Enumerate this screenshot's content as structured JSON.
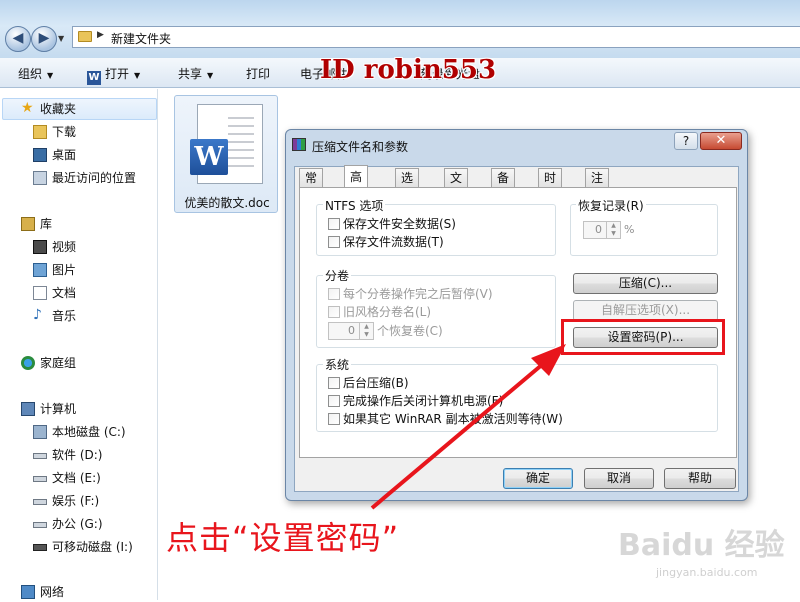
{
  "explorer": {
    "breadcrumb": "新建文件夹",
    "toolbar": {
      "organize": "组织",
      "open": "打开",
      "share": "共享",
      "print": "打印",
      "email": "电子邮件",
      "burn": "刻录到光盘"
    },
    "sidebar": {
      "favorites": "收藏夹",
      "downloads": "下载",
      "desktop": "桌面",
      "recent": "最近访问的位置",
      "libraries": "库",
      "videos": "视频",
      "pictures": "图片",
      "documents": "文档",
      "music": "音乐",
      "homegroup": "家庭组",
      "computer": "计算机",
      "drives": [
        "本地磁盘 (C:)",
        "软件 (D:)",
        "文档 (E:)",
        "娱乐 (F:)",
        "办公 (G:)",
        "可移动磁盘 (I:)"
      ],
      "network": "网络"
    },
    "file": {
      "name": "优美的散文.doc"
    }
  },
  "watermark": "ID robin553",
  "dialog": {
    "title": "压缩文件名和参数",
    "help": "?",
    "close": "✕",
    "tabs": [
      "常规",
      "高级",
      "选项",
      "文件",
      "备份",
      "时间",
      "注释"
    ],
    "active_tab": "高级",
    "ntfs": {
      "title": "NTFS 选项",
      "items": [
        "保存文件安全数据(S)",
        "保存文件流数据(T)"
      ]
    },
    "recovery": {
      "title": "恢复记录(R)",
      "value": "0",
      "unit": "%"
    },
    "volumes": {
      "title": "分卷",
      "items": [
        "每个分卷操作完之后暂停(V)",
        "旧风格分卷名(L)"
      ],
      "spin_value": "0",
      "spin_label": "个恢复卷(C)"
    },
    "buttons": {
      "compress": "压缩(C)...",
      "sfx": "自解压选项(X)...",
      "set_password": "设置密码(P)...",
      "ok": "确定",
      "cancel": "取消",
      "help": "帮助"
    },
    "system": {
      "title": "系统",
      "items": [
        "后台压缩(B)",
        "完成操作后关闭计算机电源(F)",
        "如果其它 WinRAR 副本被激活则等待(W)"
      ]
    }
  },
  "annotation": "点击“设置密码”",
  "branding": {
    "logo": "Baidu 经验",
    "url": "jingyan.baidu.com"
  },
  "colors": {
    "annotation": "#e8151c",
    "word_blue": "#2a5699"
  }
}
